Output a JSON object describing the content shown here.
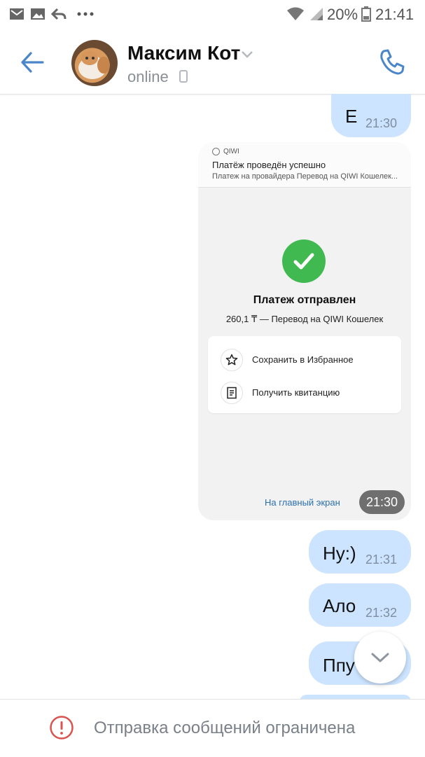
{
  "status_bar": {
    "battery_percent": "20%",
    "time": "21:41",
    "notification_icons": [
      "gmail-icon",
      "image-icon",
      "reply-icon",
      "more-icon"
    ]
  },
  "header": {
    "contact_name": "Максим Кот",
    "presence": "online"
  },
  "messages": [
    {
      "text": "Е",
      "time": "21:30"
    },
    {
      "text": "Ну:)",
      "time": "21:31"
    },
    {
      "text": "Ало",
      "time": "21:32"
    },
    {
      "text": "Ппу",
      "time": ""
    }
  ],
  "qiwi_card": {
    "brand": "QIWI",
    "notification_title": "Платёж проведён успешно",
    "notification_text": "Платеж на провайдера Перевод на QIWI Кошелек...",
    "title": "Платеж отправлен",
    "subtitle": "260,1 ₸ — Перевод на QIWI Кошелек",
    "options": [
      "Сохранить в Избранное",
      "Получить квитанцию"
    ],
    "home_link": "На главный экран",
    "time": "21:30"
  },
  "bottom_bar": {
    "restriction_text": "Отправка сообщений ограничена"
  },
  "colors": {
    "accent": "#4a86c8",
    "bubble": "#cce4ff",
    "success": "#3fb950",
    "warning": "#d9534f"
  }
}
